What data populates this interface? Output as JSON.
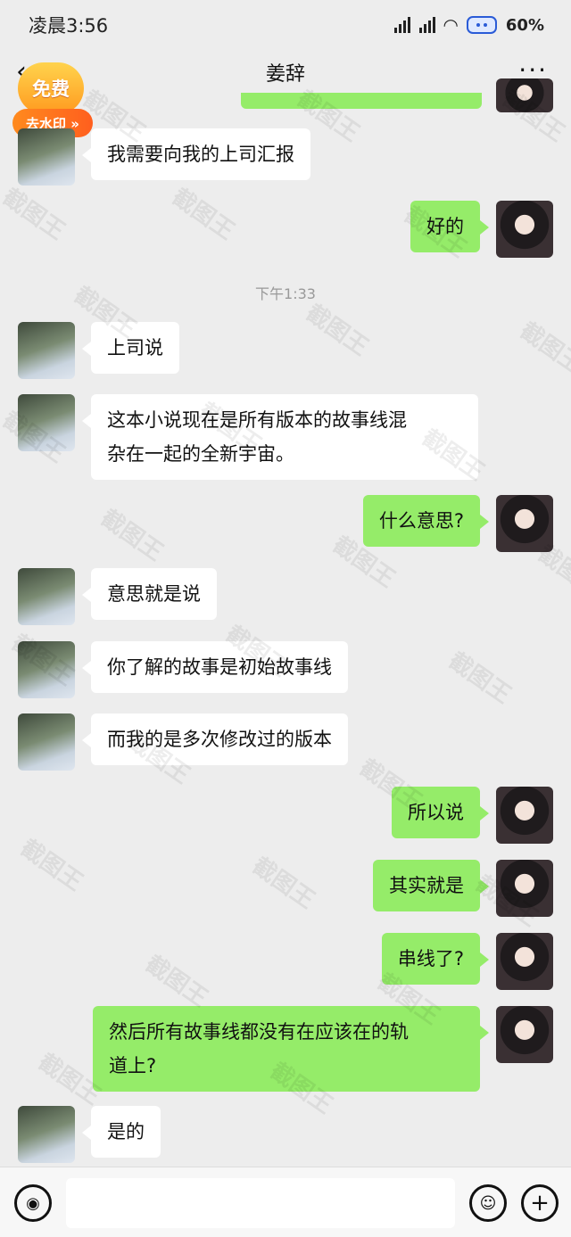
{
  "status_bar": {
    "time": "凌晨3:56",
    "battery": "60%"
  },
  "nav": {
    "back": "‹",
    "title": "姜辞",
    "more": "···"
  },
  "badge": {
    "top": "免费",
    "bottom": "去水印 »"
  },
  "watermark_text": "截图王",
  "time_label": "下午1:33",
  "messages": [
    {
      "side": "left",
      "text": "我需要向我的上司汇报"
    },
    {
      "side": "right",
      "text": "好的"
    },
    {
      "side": "left",
      "text": "上司说"
    },
    {
      "side": "left",
      "text": "这本小说现在是所有版本的故事线混",
      "text2": "杂在一起的全新宇宙。"
    },
    {
      "side": "right",
      "text": "什么意思?"
    },
    {
      "side": "left",
      "text": "意思就是说"
    },
    {
      "side": "left",
      "text": "你了解的故事是初始故事线"
    },
    {
      "side": "left",
      "text": "而我的是多次修改过的版本"
    },
    {
      "side": "right",
      "text": "所以说"
    },
    {
      "side": "right",
      "text": "其实就是"
    },
    {
      "side": "right",
      "text": "串线了?"
    },
    {
      "side": "right",
      "text": "然后所有故事线都没有在应该在的轨",
      "text2": "道上?"
    },
    {
      "side": "left",
      "text": "是的"
    }
  ],
  "input_bar": {
    "voice_icon": "voice-icon",
    "emoji_icon": "emoji-icon",
    "plus_icon": "plus-icon"
  }
}
